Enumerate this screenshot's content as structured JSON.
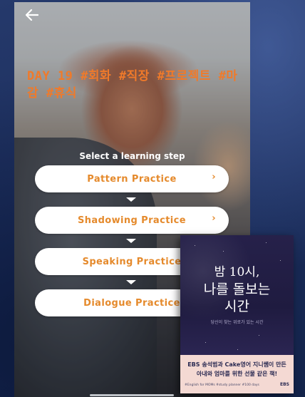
{
  "lesson": {
    "title": "DAY 19 #회화 #직장 #프로젝트 #마감 #휴식",
    "select_label": "Select a learning step",
    "back_icon": "arrow-left-icon",
    "steps": [
      {
        "label": "Pattern Practice",
        "chevron": "›"
      },
      {
        "label": "Shadowing Practice",
        "chevron": "›"
      },
      {
        "label": "Speaking Practice",
        "chevron": "›"
      },
      {
        "label": "Dialogue Practice",
        "chevron": "›"
      }
    ]
  },
  "book": {
    "title_line1": "밤 10시,",
    "title_line2": "나를 돌보는",
    "title_line3": "시간",
    "subtitle": "당신이 찾는 위로가 있는 시간",
    "band_line1": "EBS 송석범과 Cake영어 지니쌤이 만든",
    "band_line2": "아내와 엄마를 위한 선물 같은 책!",
    "band_small": "#English for MOMs #study planner #100 days",
    "logo": "EBS"
  },
  "colors": {
    "accent": "#e58a2c",
    "title": "#f07a2a",
    "background": "#1c2f5e"
  }
}
